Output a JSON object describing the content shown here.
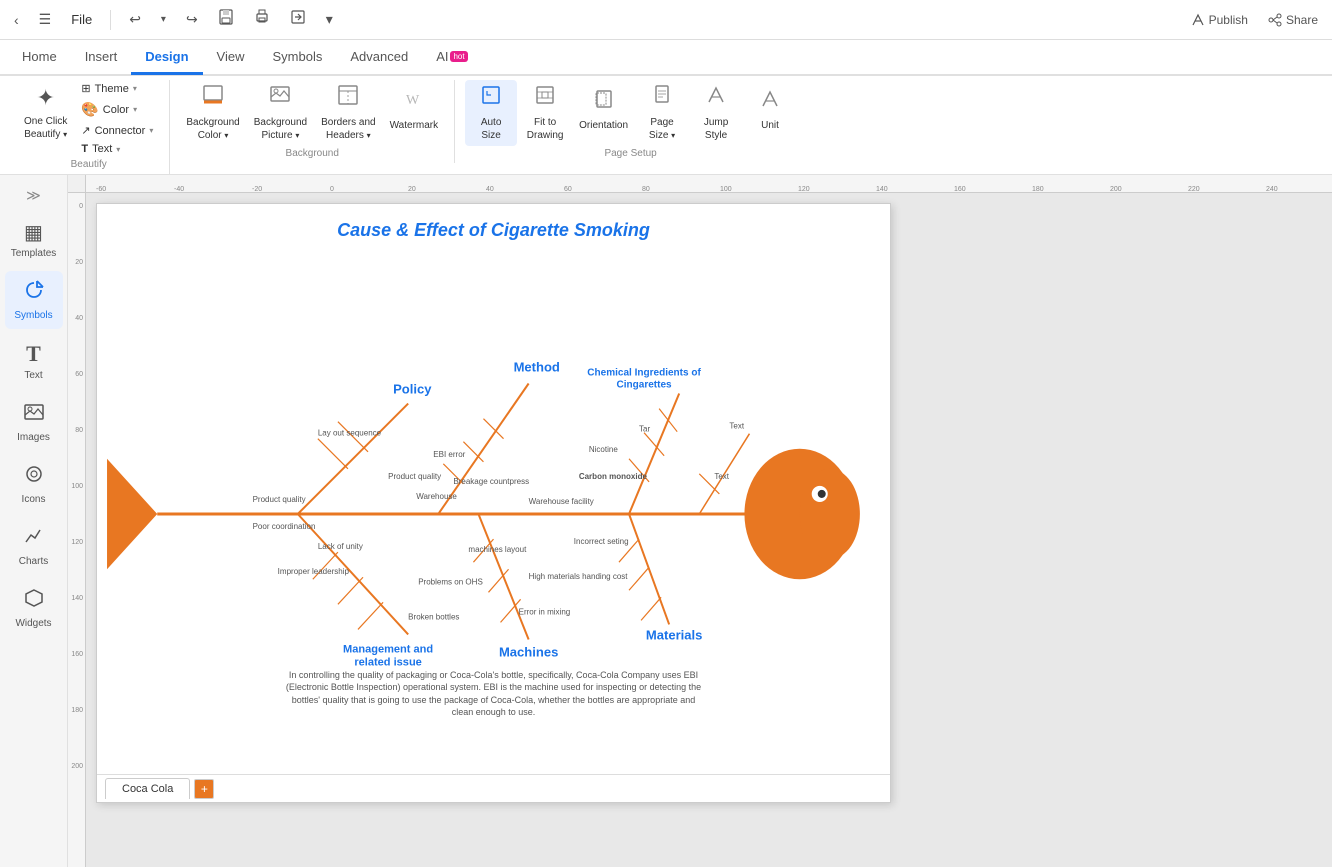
{
  "titleBar": {
    "backBtn": "‹",
    "hamburgerBtn": "☰",
    "fileLabel": "File",
    "undoBtn": "↩",
    "redoBtn": "↪",
    "saveBtn": "💾",
    "printBtn": "🖨",
    "exportBtn": "↗",
    "moreBtn": "▾"
  },
  "navTabs": [
    {
      "id": "home",
      "label": "Home"
    },
    {
      "id": "insert",
      "label": "Insert"
    },
    {
      "id": "design",
      "label": "Design",
      "active": true
    },
    {
      "id": "view",
      "label": "View"
    },
    {
      "id": "symbols",
      "label": "Symbols"
    },
    {
      "id": "advanced",
      "label": "Advanced"
    },
    {
      "id": "ai",
      "label": "AI",
      "badge": "hot"
    }
  ],
  "ribbon": {
    "groups": [
      {
        "id": "beautify",
        "label": "Beautify",
        "items": [
          {
            "id": "one-click-beautify",
            "icon": "✦",
            "label": "One Click\nBeautify",
            "tall": true,
            "caret": true
          },
          {
            "id": "theme-group",
            "small": true,
            "items": [
              {
                "id": "theme",
                "icon": "⊞",
                "label": "Theme",
                "caret": true
              },
              {
                "id": "color",
                "icon": "🎨",
                "label": "Color",
                "caret": true
              },
              {
                "id": "connector",
                "icon": "↗",
                "label": "Connector",
                "caret": true
              },
              {
                "id": "text",
                "icon": "T",
                "label": "Text",
                "caret": true
              }
            ]
          }
        ]
      },
      {
        "id": "background",
        "label": "Background",
        "items": [
          {
            "id": "bg-color",
            "icon": "🖼",
            "label": "Background\nColor",
            "tall": true,
            "caret": true
          },
          {
            "id": "bg-picture",
            "icon": "🏞",
            "label": "Background\nPicture",
            "tall": true,
            "caret": true
          },
          {
            "id": "borders-headers",
            "icon": "⊟",
            "label": "Borders and\nHeaders",
            "tall": true,
            "caret": true
          },
          {
            "id": "watermark",
            "icon": "💧",
            "label": "Watermark",
            "tall": true
          }
        ]
      },
      {
        "id": "page-setup",
        "label": "Page Setup",
        "items": [
          {
            "id": "auto-size",
            "icon": "⊡",
            "label": "Auto\nSize",
            "tall": true,
            "active": true
          },
          {
            "id": "fit-to-drawing",
            "icon": "⤢",
            "label": "Fit to\nDrawing",
            "tall": true
          },
          {
            "id": "orientation",
            "icon": "⊞",
            "label": "Orientation",
            "tall": true
          },
          {
            "id": "page-size",
            "icon": "📄",
            "label": "Page\nSize",
            "tall": true,
            "caret": true
          },
          {
            "id": "jump-style",
            "icon": "△",
            "label": "Jump\nStyle",
            "tall": true
          },
          {
            "id": "unit",
            "icon": "△",
            "label": "Unit",
            "tall": true
          }
        ]
      }
    ]
  },
  "sidebar": {
    "expandIcon": "≫",
    "items": [
      {
        "id": "templates",
        "icon": "▦",
        "label": "Templates"
      },
      {
        "id": "symbols",
        "icon": "◈",
        "label": "Symbols",
        "active": true
      },
      {
        "id": "text",
        "icon": "T",
        "label": "Text"
      },
      {
        "id": "images",
        "icon": "🖼",
        "label": "Images"
      },
      {
        "id": "icons",
        "icon": "◉",
        "label": "Icons"
      },
      {
        "id": "charts",
        "icon": "📈",
        "label": "Charts"
      },
      {
        "id": "widgets",
        "icon": "❖",
        "label": "Widgets"
      }
    ]
  },
  "canvas": {
    "diagram": {
      "title": "Cause & Effect of Cigarette Smoking",
      "labels": {
        "policy": "Policy",
        "method": "Method",
        "chemical": "Chemical Ingredients of\nCingarettes",
        "management": "Management and\nrelated issue",
        "machines": "Machines",
        "materials": "Materials"
      },
      "smallLabels": [
        "Lay out sequence",
        "EBI error",
        "Nicotine",
        "Tar",
        "Text",
        "Text",
        "Product quality",
        "Product quality",
        "Warehouse",
        "Breakage countpress",
        "Warehouse facility",
        "Carbon monoxide",
        "Poor coordination",
        "Lack of unity",
        "machines layout",
        "Incorrect seting",
        "Problems on OHS",
        "High materials handing cost",
        "Improper leadership",
        "Broken bottles",
        "Error in mixing"
      ],
      "description": "In controlling the quality of packaging or Coca-Cola's bottle, specifically, Coca-Cola Company uses EBI (Electronic Bottle Inspection) operational system. EBI is the machine used for inspecting or detecting the bottles' quality that is going to use the package of Coca-Cola, whether the bottles are appropriate and clean enough to use.",
      "tabName": "Coca Cola"
    }
  },
  "colors": {
    "orange": "#e87722",
    "blue": "#1a73e8",
    "activeTab": "#1a73e8",
    "ribbonActive": "#e8f0fe"
  }
}
